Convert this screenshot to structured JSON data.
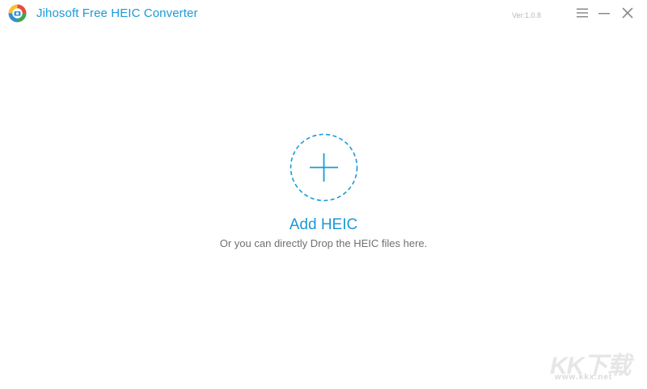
{
  "app": {
    "title": "Jihosoft Free HEIC Converter",
    "version": "Ver:1.0.8",
    "accent_color": "#1a9ad6"
  },
  "window_controls": {
    "menu_icon": "hamburger-menu-icon",
    "minimize_icon": "minimize-icon",
    "close_icon": "close-icon"
  },
  "drop_zone": {
    "icon": "plus-icon",
    "title": "Add HEIC",
    "hint": "Or you can directly Drop the HEIC files here."
  },
  "watermark": {
    "brand": "KK下载",
    "url": "www.kkx.net"
  }
}
